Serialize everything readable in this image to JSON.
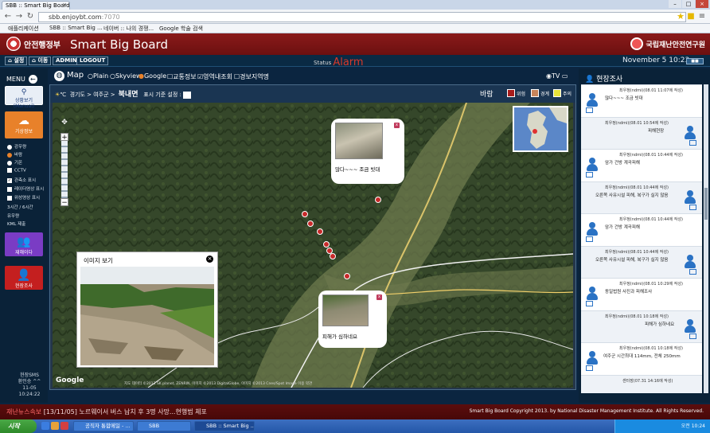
{
  "browser": {
    "tab_title": "SBB :: Smart Big Board",
    "url": "sbb.enjoybt.com",
    "url_port": ":7070",
    "bookmarks": [
      "애플리케이션",
      "SBB :: Smart Big ...",
      "네이버 :: 나의 경쟁...",
      "Google 학술 검색"
    ]
  },
  "header": {
    "org_left": "안전행정부",
    "title": "Smart Big Board",
    "org_right": "국립재난안전연구원"
  },
  "subbar": {
    "buttons": [
      "설정",
      "이동",
      "ADMIN",
      "LOGOUT"
    ],
    "status_label": "Status",
    "status_value": "Alarm",
    "datetime": "November 5 10:23"
  },
  "leftmenu": {
    "title": "MENU",
    "items": [
      {
        "label": "상황보기 (Manual)"
      },
      {
        "label": "기상정보"
      },
      {
        "label": "재해이다"
      },
      {
        "label": "현장조사"
      }
    ],
    "options": [
      "강우량",
      "바람",
      "기온",
      "CCTV",
      "관측소 표시",
      "레이더영상 표시",
      "위성영상 표시",
      "3시간 / 6시간",
      "유우량",
      "KML 제출"
    ],
    "sms": [
      "현장SMS",
      "환인승 ^^",
      "11-05 10:24:22"
    ]
  },
  "maptools": {
    "map_label": "Map",
    "modes": [
      "Plain",
      "Skyview",
      "Google"
    ],
    "layers": [
      "교통정보",
      "영역내조회",
      "경보지역명"
    ],
    "tv_label": "TV"
  },
  "mapheader": {
    "temp_unit": "℃",
    "region": "경기도 > 여주군 >",
    "district": "북내면",
    "set_label": "표시 기준 설정 :",
    "wind_label": "바람",
    "legend": [
      "위험",
      "경계",
      "주의"
    ]
  },
  "map": {
    "bubble1_caption": "많다~~~  조금 빗대",
    "bubble2_caption": "피해가 심하네요",
    "popup_title": "이미지 보기",
    "google": "Google",
    "copyright": "지도 데이터 ©2013 SK planet, ZENRIN, 이미지 ©2013 DigitalGlobe, 이미지 ©2013 Cnes/Spot Image 이용 약관"
  },
  "rightpanel": {
    "title": "현장조사",
    "entries": [
      {
        "meta": "최우정(ndmi)(08.01 11:07에 작성)",
        "msg": "많다~~~ 조금 빗대"
      },
      {
        "meta": "최우정(ndmi)(08.01 10:54에 작성)",
        "msg": "피해현장"
      },
      {
        "meta": "최우정(ndmi)(08.01 10:44에 작성)",
        "msg": "암가 건방 계곡피해"
      },
      {
        "meta": "최우정(ndmi)(08.01 10:44에 작성)",
        "msg": "오른쪽 사유시설 피해, 복구가 실지 않음"
      },
      {
        "meta": "최우정(ndmi)(08.01 10:44에 작성)",
        "msg": "암가 건방 계곡피해"
      },
      {
        "meta": "최우정(ndmi)(08.01 10:44에 작성)",
        "msg": "오른쪽 사유시설 피해, 복구가 실지 않음"
      },
      {
        "meta": "최우정(ndmi)(08.01 10:29에 작성)",
        "msg": "동일법원 사진과 피해조사"
      },
      {
        "meta": "최우정(ndmi)(08.01 10:18에 작성)",
        "msg": "피해가 심하네요"
      },
      {
        "meta": "최우정(ndmi)(08.01 10:18에 작성)",
        "msg": "여주군 시간최대 114mm, 전체 250mm"
      },
      {
        "meta": "센터장(07.31 14:16에 작성)",
        "msg": ""
      }
    ]
  },
  "ticker": {
    "prefix": "재난뉴스속보",
    "news": "[13/11/05] 노르웨이서 버스 납치 후 3명 사망...현행범 체포",
    "copyright": "Smart Big Board Copyright 2013. by National Disaster Management Institute. All Rights Reserved."
  },
  "taskbar": {
    "start": "시작",
    "tasks": [
      "공직자 통합메일 - ...",
      "SBB",
      "SBB :: Smart Big ..."
    ],
    "clock": "오전 10:24"
  },
  "colors": {
    "header_red": "#7a1414",
    "panel_navy": "#0a2238",
    "alarm_red": "#d8392b",
    "danger": "#a61c1c",
    "warning": "#c7845a",
    "caution": "#e6e23a"
  }
}
